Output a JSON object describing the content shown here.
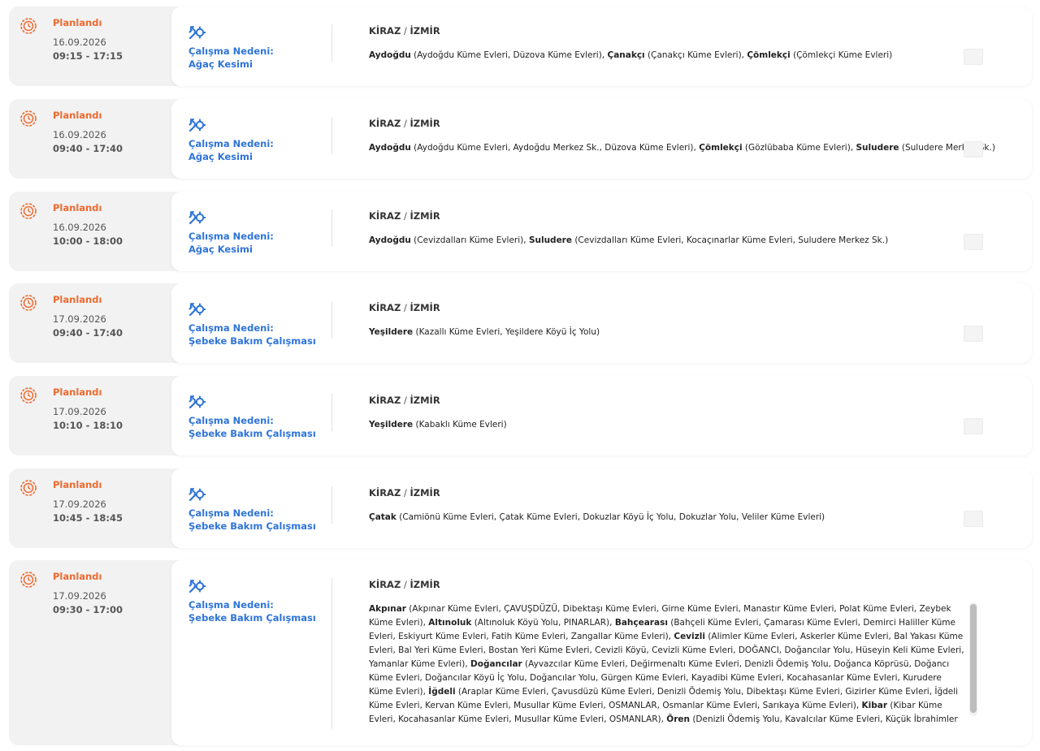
{
  "outages": [
    {
      "status": "Planlandı",
      "date": "16.09.2026",
      "time": "09:15 - 17:15",
      "reason_title": "Çalışma Nedeni:",
      "reason": "Ağaç Kesimi",
      "district": "KİRAZ",
      "city": "İZMİR",
      "neighborhoods": [
        {
          "name": "Aydoğdu",
          "streets": " (Aydoğdu Küme Evleri, Düzova Küme Evleri), "
        },
        {
          "name": "Çanakçı",
          "streets": " (Çanakçı Küme Evleri), "
        },
        {
          "name": "Çömlekçi",
          "streets": " (Çömlekçi Küme Evleri)"
        }
      ]
    },
    {
      "status": "Planlandı",
      "date": "16.09.2026",
      "time": "09:40 - 17:40",
      "reason_title": "Çalışma Nedeni:",
      "reason": "Ağaç Kesimi",
      "district": "KİRAZ",
      "city": "İZMİR",
      "neighborhoods": [
        {
          "name": "Aydoğdu",
          "streets": " (Aydoğdu Küme Evleri, Aydoğdu Merkez Sk., Düzova Küme Evleri), "
        },
        {
          "name": "Çömlekçi",
          "streets": " (Gözlübaba Küme Evleri), "
        },
        {
          "name": "Suludere",
          "streets": " (Suludere Merkez Sk.)"
        }
      ]
    },
    {
      "status": "Planlandı",
      "date": "16.09.2026",
      "time": "10:00 - 18:00",
      "reason_title": "Çalışma Nedeni:",
      "reason": "Ağaç Kesimi",
      "district": "KİRAZ",
      "city": "İZMİR",
      "neighborhoods": [
        {
          "name": "Aydoğdu",
          "streets": " (Cevizdalları Küme Evleri), "
        },
        {
          "name": "Suludere",
          "streets": " (Cevizdalları Küme Evleri, Kocaçınarlar Küme Evleri, Suludere Merkez Sk.)"
        }
      ]
    },
    {
      "status": "Planlandı",
      "date": "17.09.2026",
      "time": "09:40 - 17:40",
      "reason_title": "Çalışma Nedeni:",
      "reason": "Şebeke Bakım Çalışması",
      "district": "KİRAZ",
      "city": "İZMİR",
      "neighborhoods": [
        {
          "name": "Yeşildere",
          "streets": " (Kazallı Küme Evleri, Yeşildere Köyü İç Yolu)"
        }
      ]
    },
    {
      "status": "Planlandı",
      "date": "17.09.2026",
      "time": "10:10 - 18:10",
      "reason_title": "Çalışma Nedeni:",
      "reason": "Şebeke Bakım Çalışması",
      "district": "KİRAZ",
      "city": "İZMİR",
      "neighborhoods": [
        {
          "name": "Yeşildere",
          "streets": " (Kabaklı Küme Evleri)"
        }
      ]
    },
    {
      "status": "Planlandı",
      "date": "17.09.2026",
      "time": "10:45 - 18:45",
      "reason_title": "Çalışma Nedeni:",
      "reason": "Şebeke Bakım Çalışması",
      "district": "KİRAZ",
      "city": "İZMİR",
      "neighborhoods": [
        {
          "name": "Çatak",
          "streets": " (Camiönü Küme Evleri, Çatak Küme Evleri, Dokuzlar Köyü İç Yolu, Dokuzlar Yolu, Veliler Küme Evleri)"
        }
      ]
    },
    {
      "status": "Planlandı",
      "date": "17.09.2026",
      "time": "09:30 - 17:00",
      "reason_title": "Çalışma Nedeni:",
      "reason": "Şebeke Bakım Çalışması",
      "district": "KİRAZ",
      "city": "İZMİR",
      "neighborhoods": [
        {
          "name": "Akpınar",
          "streets": " (Akpınar Küme Evleri, ÇAVUŞDÜZÜ, Dibektaşı Küme Evleri, Girne Küme Evleri, Manastır Küme Evleri, Polat Küme Evleri, Zeybek Küme Evleri), "
        },
        {
          "name": "Altınoluk",
          "streets": " (Altınoluk Köyü Yolu, PINARLAR), "
        },
        {
          "name": "Bahçearası",
          "streets": " (Bahçeli Küme Evleri, Çamarası Küme Evleri, Demirci Haliller Küme Evleri, Eskiyurt Küme Evleri, Fatih Küme Evleri, Zangallar Küme Evleri), "
        },
        {
          "name": "Cevizli",
          "streets": " (Alimler Küme Evleri, Askerler Küme Evleri, Bal Yakası Küme Evleri, Bal Yeri Küme Evleri, Bostan Yeri Küme Evleri, Cevizli Köyü, Cevizli Küme Evleri, DOĞANCI, Doğancılar Yolu, Hüseyin Keli Küme Evleri, Yamanlar Küme Evleri), "
        },
        {
          "name": "Doğancılar",
          "streets": " (Ayvazcılar Küme Evleri, Değirmenaltı Küme Evleri, Denizli Ödemiş Yolu, Doğanca Köprüsü, Doğancı Küme Evleri, Doğancılar Köyü İç Yolu, Doğancılar Yolu, Gürgen Küme Evleri, Kayadibi Küme Evleri, Kocahasanlar Küme Evleri, Kurudere Küme Evleri), "
        },
        {
          "name": "İğdeli",
          "streets": " (Araplar Küme Evleri, Çavusdüzü Küme Evleri, Denizli Ödemiş Yolu, Dibektaşı Küme Evleri, Gizirler Küme Evleri, İğdeli Küme Evleri, Kervan Küme Evleri, Musullar Küme Evleri, OSMANLAR, Osmanlar Küme Evleri, Sarıkaya Küme Evleri), "
        },
        {
          "name": "Kibar",
          "streets": " (Kibar Küme Evleri, Kocahasanlar Küme Evleri, Musullar Küme Evleri, OSMANLAR), "
        },
        {
          "name": "Ören",
          "streets": " (Denizli Ödemiş Yolu, Kavalcılar Küme Evleri, Küçük İbrahimler Küme Evleri, Küçükören Küme Evleri, Manastır Küme Evleri,"
        }
      ]
    }
  ],
  "colors": {
    "status": "#ef6a2f",
    "reason": "#2e74d9"
  },
  "icons": {
    "status": "gear-clock-icon",
    "reason": "wrench-settings-icon"
  }
}
